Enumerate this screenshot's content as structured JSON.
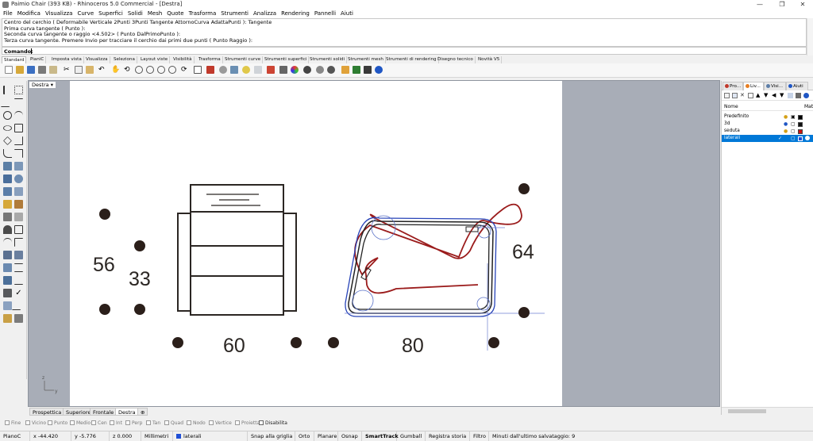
{
  "window": {
    "title": "Paimio Chair (393 KB) - Rhinoceros 5.0 Commercial - [Destra]",
    "minimize": "—",
    "maximize": "❐",
    "close": "✕"
  },
  "menu": [
    "File",
    "Modifica",
    "Visualizza",
    "Curve",
    "Superfici",
    "Solidi",
    "Mesh",
    "Quote",
    "Trasforma",
    "Strumenti",
    "Analizza",
    "Rendering",
    "Pannelli",
    "Aiuti"
  ],
  "command_history": [
    "Centro del cerchio ( Deformabile  Verticale  2Punti  3Punti  Tangente  AttornoCurva  AdattaPunti ): Tangente",
    "Prima curva tangente ( Punto ):",
    "Seconda curva tangente o raggio <4.502> ( Punto  DalPrimoPunto ):",
    "Terza curva tangente. Premere Invio per tracciare il cerchio dai primi due punti ( Punto  Raggio ):"
  ],
  "command_prompt": "Comando:",
  "toolbar_tabs": [
    "Standard",
    "PianiC",
    "Imposta vista",
    "Visualizza",
    "Seleziona",
    "Layout viste",
    "Visibilità",
    "Trasforma",
    "Strumenti curve",
    "Strumenti superfici",
    "Strumenti solidi",
    "Strumenti mesh",
    "Strumenti di rendering",
    "Disegno tecnico",
    "Novità V5"
  ],
  "viewport": {
    "label": "Destra",
    "menu_arrow": "▾",
    "axis_z": "z",
    "axis_y": "y"
  },
  "dimensions": {
    "seat_depth": "56",
    "seat_height": "33",
    "front_width": "60",
    "side_length": "80",
    "side_height": "64"
  },
  "viewport_tabs": [
    "Prospettica",
    "Superiore",
    "Frontale",
    "Destra",
    "⊕"
  ],
  "osnaps": [
    {
      "label": "Fine",
      "checked": false
    },
    {
      "label": "Vicino",
      "checked": false
    },
    {
      "label": "Punto",
      "checked": false
    },
    {
      "label": "Medio",
      "checked": false
    },
    {
      "label": "Cen",
      "checked": false
    },
    {
      "label": "Int",
      "checked": false
    },
    {
      "label": "Perp",
      "checked": false
    },
    {
      "label": "Tan",
      "checked": false
    },
    {
      "label": "Quad",
      "checked": false
    },
    {
      "label": "Nodo",
      "checked": false
    },
    {
      "label": "Vertice",
      "checked": false
    },
    {
      "label": "Proietta",
      "checked": false
    },
    {
      "label": "Disabilita",
      "checked": true
    }
  ],
  "status": {
    "cplane": "PianoC",
    "x": "x -44.420",
    "y": "y -5.776",
    "z": "z 0.000",
    "units": "Millimetri",
    "layer": "laterali",
    "layer_color": "#1f4fd6",
    "snap_grid": "Snap alla griglia",
    "ortho": "Orto",
    "planar": "Planare",
    "osnap": "Osnap",
    "smarttrack": "SmartTrack",
    "gumball": "Gumball",
    "history": "Registra storia",
    "filter": "Filtro",
    "autosave": "Minuti dall'ultimo salvataggio: 9"
  },
  "panel": {
    "tabs": [
      "Pro...",
      "Liv...",
      "Visi...",
      "Aiuti"
    ],
    "col_name": "Nome",
    "col_material": "Mat",
    "layers": [
      {
        "name": "Predefinito",
        "color": "#000000",
        "selected": false
      },
      {
        "name": "3d",
        "color": "#111111",
        "selected": false
      },
      {
        "name": "seduta",
        "color": "#cc1010",
        "selected": false
      },
      {
        "name": "laterali",
        "color": "#1f4fd6",
        "selected": true
      }
    ]
  }
}
